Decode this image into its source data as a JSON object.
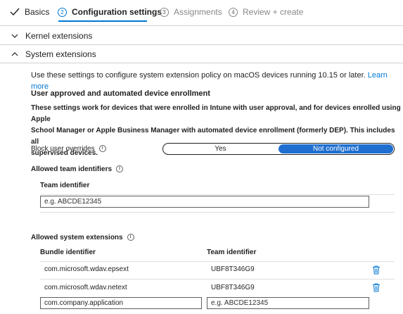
{
  "wizard": {
    "steps": [
      {
        "number": "",
        "label": "Basics",
        "state": "done"
      },
      {
        "number": "2",
        "label": "Configuration settings",
        "state": "current"
      },
      {
        "number": "3",
        "label": "Assignments",
        "state": "upcoming"
      },
      {
        "number": "4",
        "label": "Review + create",
        "state": "upcoming"
      }
    ]
  },
  "sections": {
    "kernel": {
      "label": "Kernel extensions",
      "icon": "chevron-down-icon"
    },
    "system": {
      "label": "System extensions",
      "icon": "chevron-up-icon"
    }
  },
  "intro": {
    "text": "Use these settings to configure system extension policy on macOS devices running 10.15 or later.",
    "link": "Learn more"
  },
  "enrollment": {
    "heading": "User approved and automated device enrollment",
    "line1": "These settings work for devices that were enrolled in Intune with user approval, and for devices enrolled using Apple",
    "line2": "School Manager or Apple Business Manager with automated device enrollment (formerly DEP). This includes all",
    "line3": "supervised devices."
  },
  "block_overrides": {
    "label": "Block user overrides",
    "options": [
      "Yes",
      "Not configured"
    ],
    "selected": "Not configured"
  },
  "team_ids": {
    "label": "Allowed team identifiers",
    "column": "Team identifier",
    "placeholder": "e.g. ABCDE12345"
  },
  "system_extensions": {
    "label": "Allowed system extensions",
    "columns": {
      "bundle": "Bundle identifier",
      "team": "Team identifier"
    },
    "rows": [
      {
        "bundle": "com.microsoft.wdav.epsext",
        "team": "UBF8T346G9"
      },
      {
        "bundle": "com.microsoft.wdav.netext",
        "team": "UBF8T346G9"
      }
    ],
    "new_row": {
      "bundle_value": "com.company.application",
      "team_placeholder": "e.g. ABCDE12345"
    }
  },
  "colors": {
    "accent": "#0078d4",
    "toggle_selected": "#1f6fd0"
  }
}
